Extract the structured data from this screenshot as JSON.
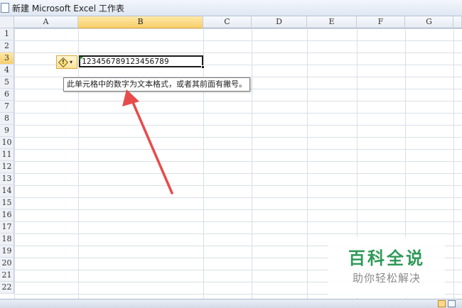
{
  "window": {
    "title": "新建 Microsoft Excel 工作表"
  },
  "columns": [
    "A",
    "B",
    "C",
    "D",
    "E",
    "F",
    "G"
  ],
  "rows": [
    "1",
    "2",
    "3",
    "4",
    "5",
    "6",
    "7",
    "8",
    "9",
    "10",
    "11",
    "12",
    "13",
    "14",
    "15",
    "16",
    "17",
    "18",
    "19",
    "20",
    "21",
    "22"
  ],
  "active_cell": {
    "column": "B",
    "row": "3",
    "value": "123456789123456789"
  },
  "error_button": {
    "icon": "warning-diamond-icon",
    "glyph": "!",
    "dropdown_glyph": "▾"
  },
  "tooltip": {
    "text": "此单元格中的数字为文本格式，或者其前面有撇号。"
  },
  "annotation": {
    "color": "#e84b4b"
  },
  "watermark": {
    "brand": "百科全说",
    "tagline": "助你轻松解决"
  },
  "colors": {
    "accent_header": "#f7cf6b",
    "error_indicator": "#2e8b2e",
    "watermark": "#2e9a58"
  }
}
